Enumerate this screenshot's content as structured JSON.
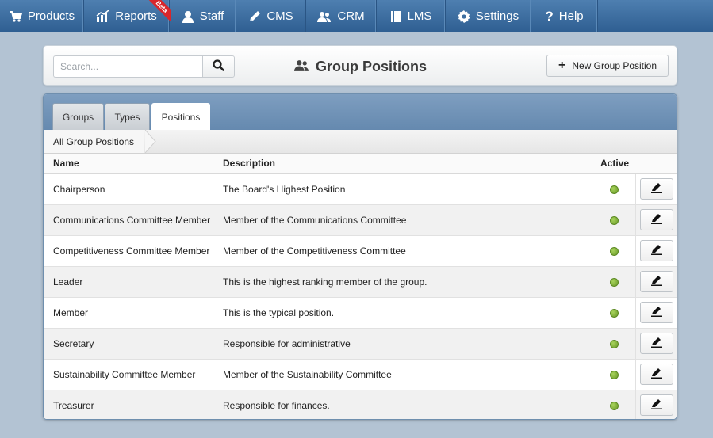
{
  "nav": {
    "items": [
      {
        "label": "Products",
        "icon": "cart-icon"
      },
      {
        "label": "Reports",
        "icon": "chart-icon",
        "badge": "Beta"
      },
      {
        "label": "Staff",
        "icon": "user-icon"
      },
      {
        "label": "CMS",
        "icon": "pencil-icon"
      },
      {
        "label": "CRM",
        "icon": "users-icon"
      },
      {
        "label": "LMS",
        "icon": "book-icon"
      },
      {
        "label": "Settings",
        "icon": "gear-icon"
      },
      {
        "label": "Help",
        "icon": "question-icon"
      }
    ]
  },
  "header": {
    "search_placeholder": "Search...",
    "title": "Group Positions",
    "new_button_label": "New Group Position"
  },
  "tabs": [
    {
      "label": "Groups",
      "active": false
    },
    {
      "label": "Types",
      "active": false
    },
    {
      "label": "Positions",
      "active": true
    }
  ],
  "breadcrumb": "All Group Positions",
  "table": {
    "columns": {
      "name": "Name",
      "description": "Description",
      "active": "Active"
    },
    "rows": [
      {
        "name": "Chairperson",
        "description": "The Board's Highest Position",
        "active": true
      },
      {
        "name": "Communications Committee Member",
        "description": "Member of the Communications Committee",
        "active": true
      },
      {
        "name": "Competitiveness Committee Member",
        "description": "Member of the Competitiveness Committee",
        "active": true
      },
      {
        "name": "Leader",
        "description": "This is the highest ranking member of the group.",
        "active": true
      },
      {
        "name": "Member",
        "description": "This is the typical position.",
        "active": true
      },
      {
        "name": "Secretary",
        "description": "Responsible for administrative",
        "active": true
      },
      {
        "name": "Sustainability Committee Member",
        "description": "Member of the Sustainability Committee",
        "active": true
      },
      {
        "name": "Treasurer",
        "description": "Responsible for finances.",
        "active": true
      }
    ]
  },
  "colors": {
    "nav_bg": "#3d6ea0",
    "active_dot": "#86b83a",
    "beta_ribbon": "#d9262b"
  }
}
